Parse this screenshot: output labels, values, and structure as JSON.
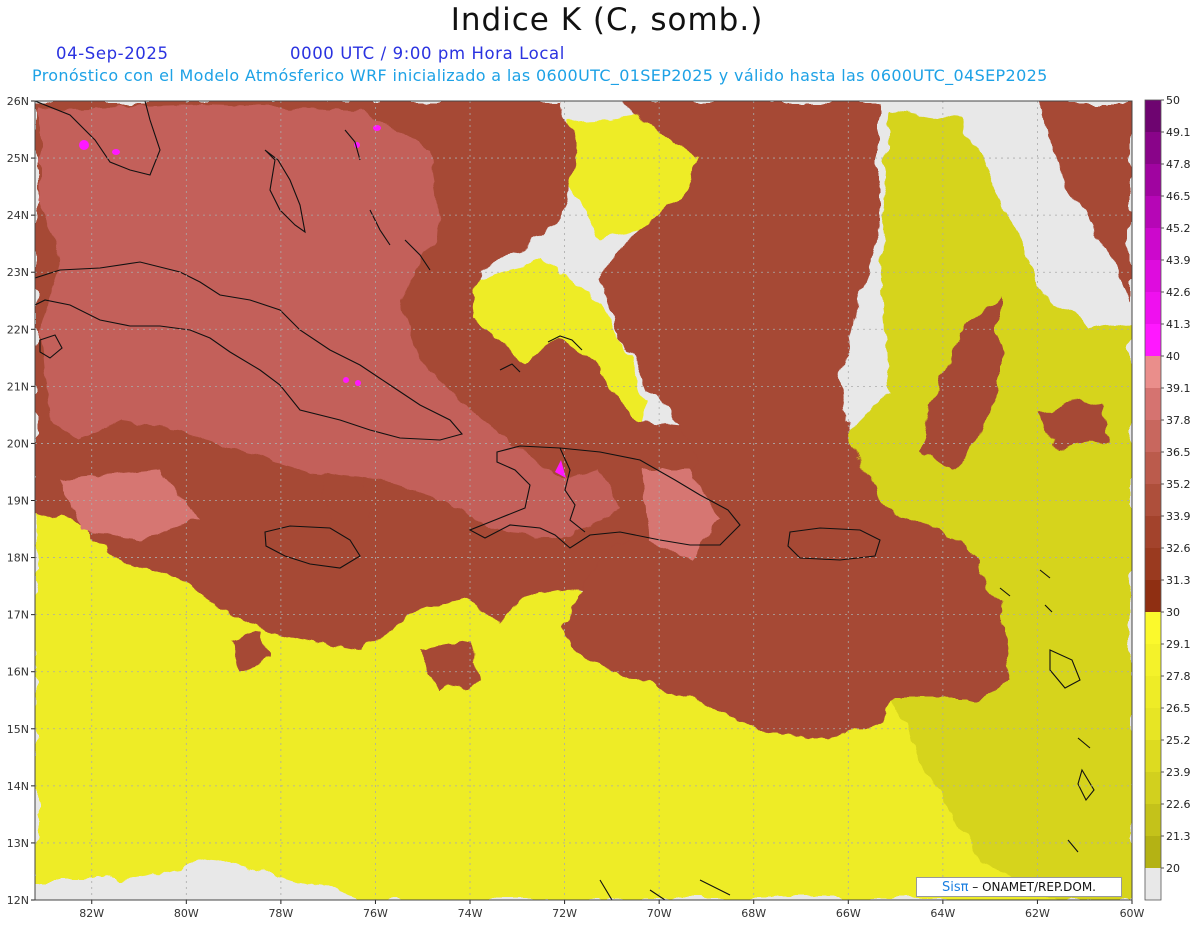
{
  "header": {
    "title": "Indice K (C, somb.)",
    "date": "04-Sep-2025",
    "time": "0000 UTC / 9:00 pm Hora Local",
    "subtitle": "Pronóstico con el Modelo Atmósferico WRF inicializado a las 0600UTC_01SEP2025 y válido hasta las  0600UTC_04SEP2025"
  },
  "axes": {
    "lat_labels": [
      "26N",
      "25N",
      "24N",
      "23N",
      "22N",
      "21N",
      "20N",
      "19N",
      "18N",
      "17N",
      "16N",
      "15N",
      "14N",
      "13N",
      "12N"
    ],
    "lon_labels": [
      "82W",
      "80W",
      "78W",
      "76W",
      "74W",
      "72W",
      "70W",
      "68W",
      "66W",
      "64W",
      "62W",
      "60W"
    ],
    "lat_range": [
      12,
      26
    ],
    "lon_range": [
      -83.2,
      -60
    ],
    "grid": "dotted"
  },
  "legend": {
    "labels": [
      "20",
      "21.3",
      "22.6",
      "23.9",
      "25.2",
      "26.5",
      "27.8",
      "29.1",
      "30",
      "31.3",
      "32.6",
      "33.9",
      "35.2",
      "36.5",
      "37.8",
      "39.1",
      "40",
      "41.3",
      "42.6",
      "43.9",
      "45.2",
      "46.5",
      "47.8",
      "49.1",
      "50"
    ],
    "colors": [
      "#b4b214",
      "#c4c21a",
      "#d2d01e",
      "#dddb20",
      "#e7e524",
      "#eeec26",
      "#f4f22a",
      "#fbf92c",
      "#8f2f12",
      "#9a3a1f",
      "#a3432c",
      "#ae4f3b",
      "#bb5b4c",
      "#c8675e",
      "#d57370",
      "#ea8e8b",
      "#ff18ff",
      "#ef10ef",
      "#de0cde",
      "#cc08cc",
      "#b606b6",
      "#a004a0",
      "#890489",
      "#6e0470"
    ],
    "below_color": "#e8e8e8"
  },
  "map": {
    "colors": {
      "ocean_low": "#e8e8e8",
      "yellow": "#eeec26",
      "yellow_dark": "#d6d41e",
      "red_dark": "#a64836",
      "red_mid": "#c3605a",
      "red_light": "#d67672",
      "magenta": "#ff18ff",
      "coast": "#111111"
    }
  },
  "credit": {
    "sis": "Sisπ",
    "dash": " – ",
    "org": "ONAMET/REP.DOM."
  }
}
